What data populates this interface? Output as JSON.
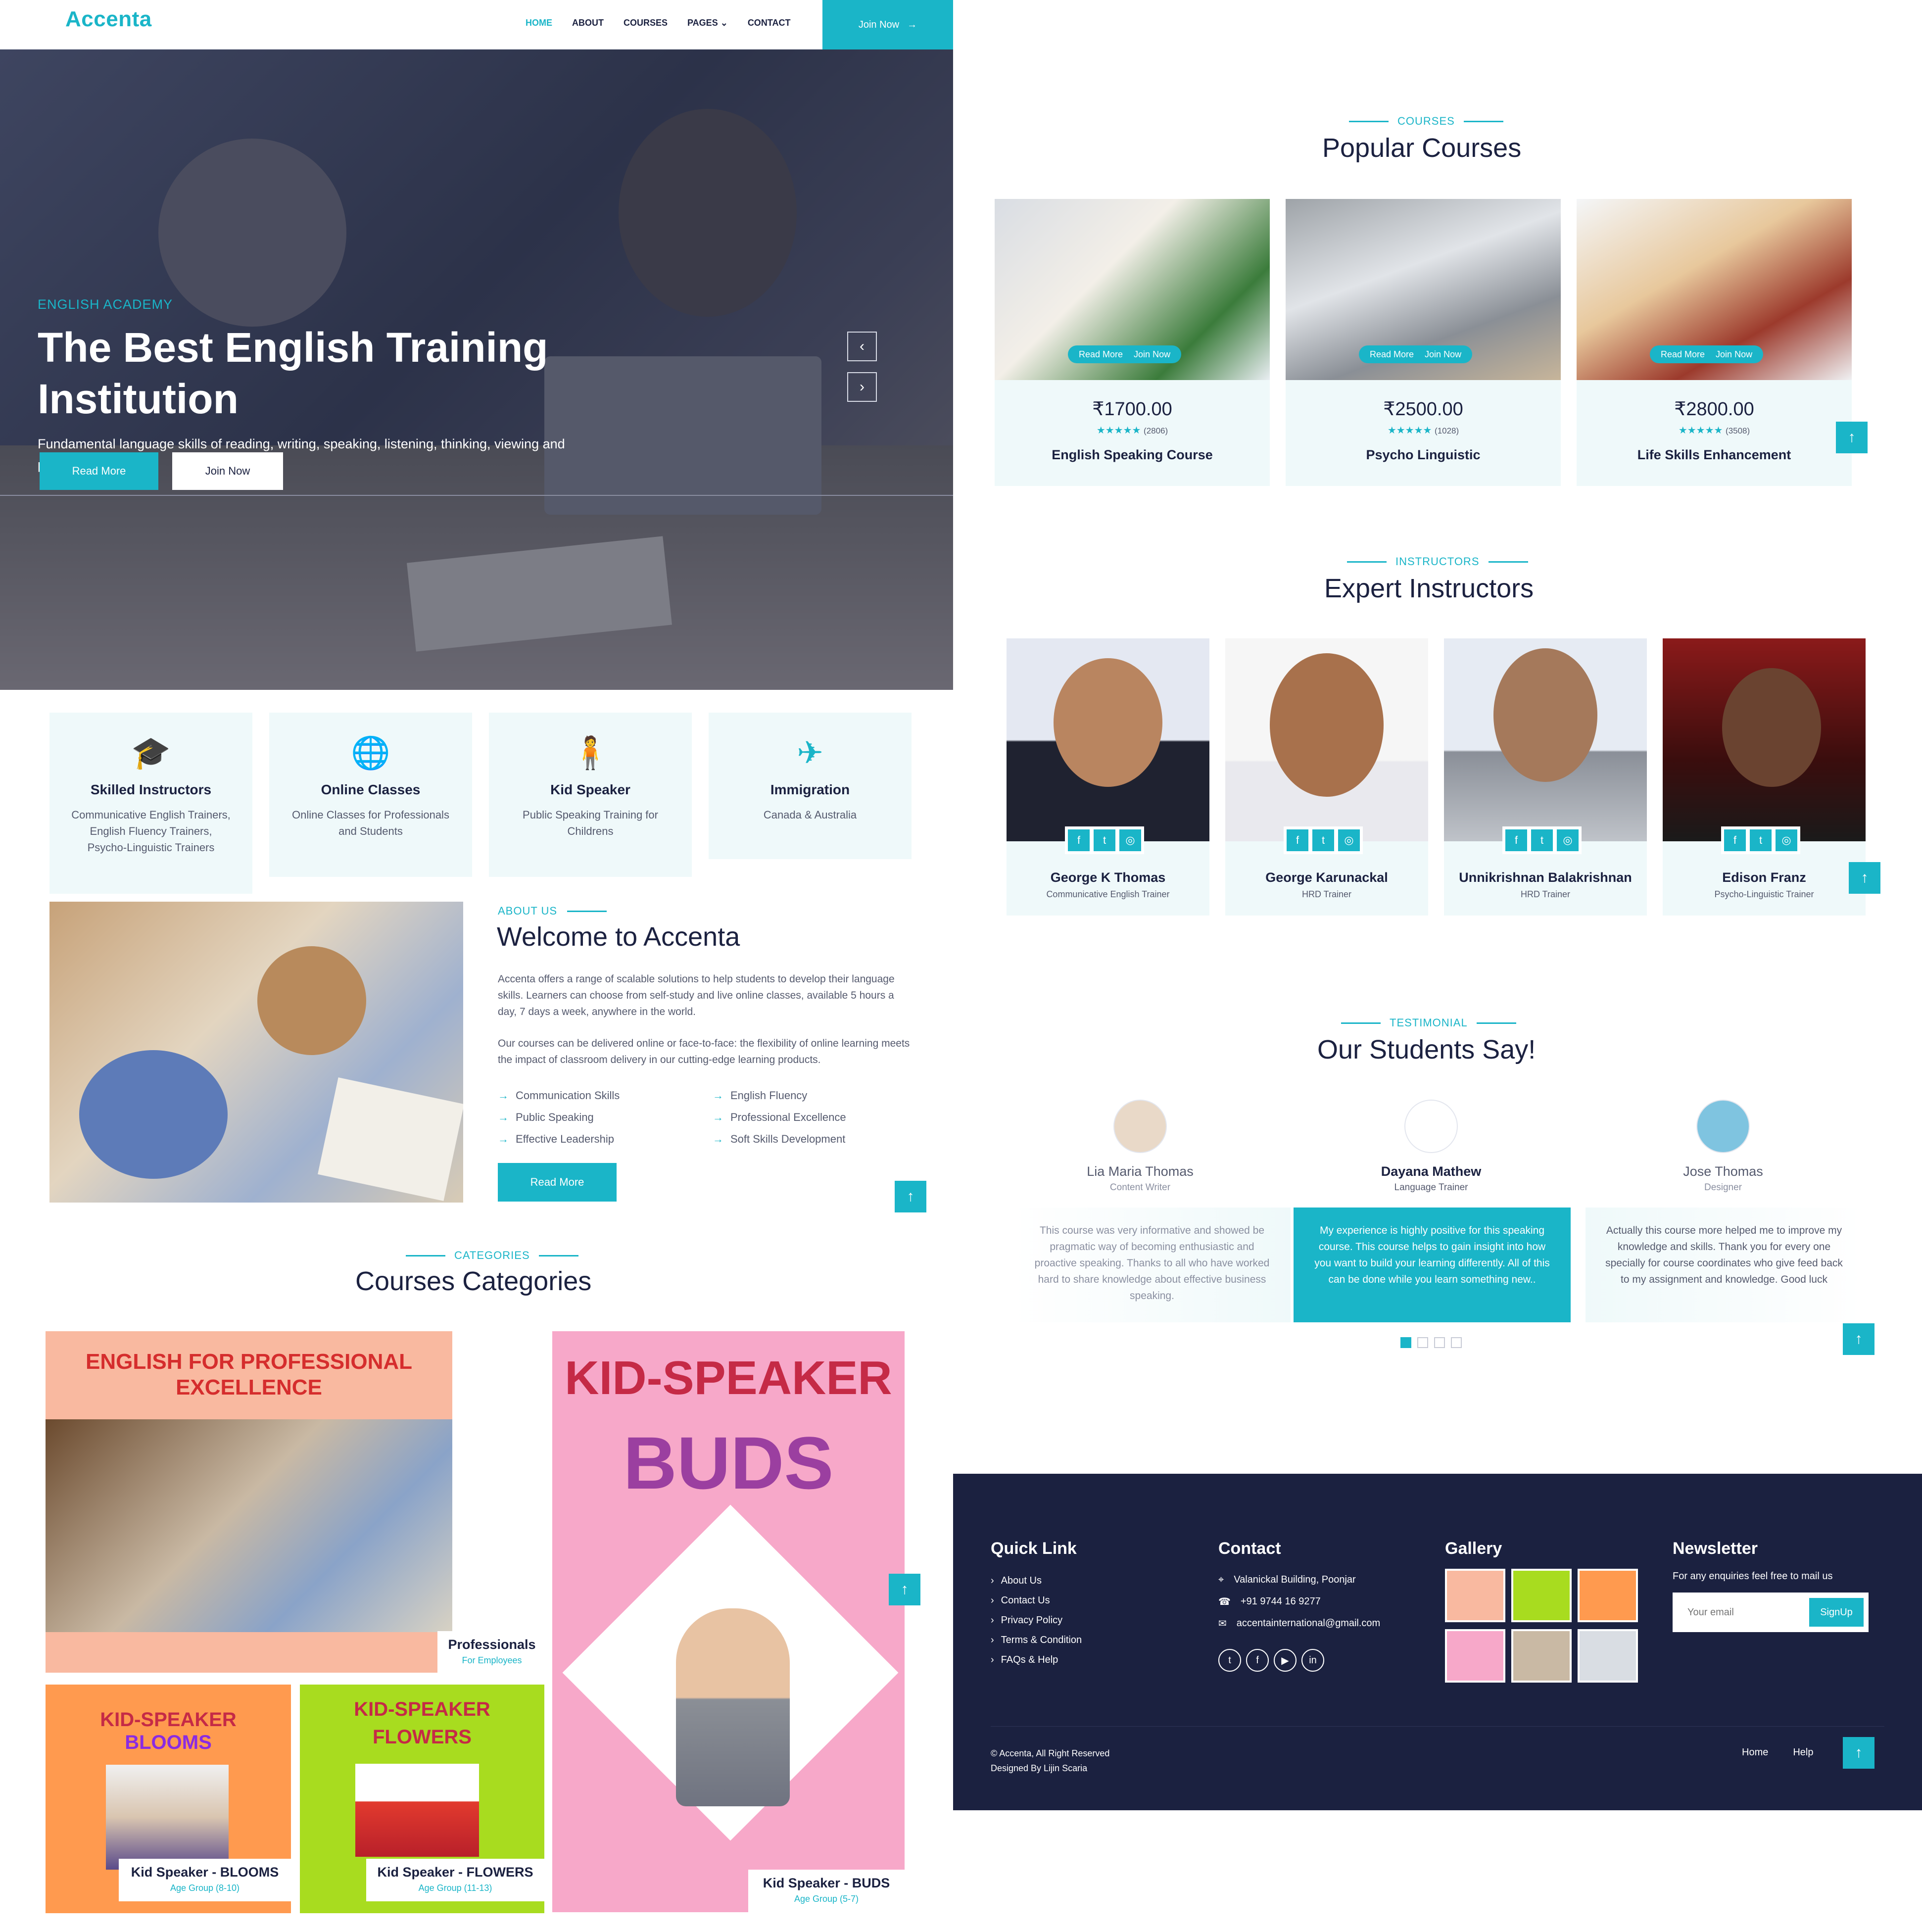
{
  "nav": {
    "logo": "Accenta",
    "items": [
      "HOME",
      "ABOUT",
      "COURSES",
      "PAGES",
      "CONTACT"
    ],
    "join_label": "Join Now"
  },
  "hero": {
    "subtitle": "ENGLISH ACADEMY",
    "title": "The Best English Training Institution",
    "description": "Fundamental language skills of reading, writing, speaking, listening, thinking, viewing and presenting.",
    "read_more": "Read More",
    "join_now": "Join Now"
  },
  "features": [
    {
      "icon": "graduation-cap-icon",
      "title": "Skilled Instructors",
      "desc": "Communicative English Trainers, English Fluency Trainers, Psycho-Linguistic Trainers"
    },
    {
      "icon": "globe-icon",
      "title": "Online Classes",
      "desc": "Online Classes for Professionals and Students"
    },
    {
      "icon": "child-icon",
      "title": "Kid Speaker",
      "desc": "Public Speaking Training for Childrens"
    },
    {
      "icon": "plane-icon",
      "title": "Immigration",
      "desc": "Canada & Australia"
    }
  ],
  "about": {
    "label": "ABOUT US",
    "title": "Welcome to Accenta",
    "p1": "Accenta offers a range of scalable solutions to help students to develop their language skills. Learners can choose from self-study and live online classes, available 5 hours a day, 7 days a week, anywhere in the world.",
    "p2": "Our courses can be delivered online or face-to-face: the flexibility of online learning meets the impact of classroom delivery in our cutting-edge learning products.",
    "list_left": [
      "Communication Skills",
      "Public Speaking",
      "Effective Leadership"
    ],
    "list_right": [
      "English Fluency",
      "Professional Excellence",
      "Soft Skills Development"
    ],
    "button": "Read More"
  },
  "categories": {
    "label": "CATEGORIES",
    "title": "Courses Categories",
    "items": [
      {
        "banner_line1": "ENGLISH FOR PROFESSIONAL",
        "banner_line2": "EXCELLENCE",
        "name": "Professionals",
        "sub": "For Employees"
      },
      {
        "banner_line1": "KID-SPEAKER",
        "banner_line2": "BUDS",
        "name": "Kid Speaker - BUDS",
        "sub": "Age Group (5-7)"
      },
      {
        "banner_line1": "KID-SPEAKER",
        "banner_line2": "BLOOMS",
        "name": "Kid Speaker - BLOOMS",
        "sub": "Age Group (8-10)"
      },
      {
        "banner_line1": "KID-SPEAKER",
        "banner_line2": "FLOWERS",
        "name": "Kid Speaker - FLOWERS",
        "sub": "Age Group (11-13)"
      }
    ]
  },
  "courses": {
    "label": "COURSES",
    "title": "Popular Courses",
    "read_more": "Read More",
    "join_now": "Join Now",
    "items": [
      {
        "price": "₹1700.00",
        "rating": 5,
        "count": "(2806)",
        "name": "English Speaking Course"
      },
      {
        "price": "₹2500.00",
        "rating": 5,
        "count": "(1028)",
        "name": "Psycho Linguistic"
      },
      {
        "price": "₹2800.00",
        "rating": 5,
        "count": "(3508)",
        "name": "Life Skills Enhancement"
      }
    ]
  },
  "instructors": {
    "label": "INSTRUCTORS",
    "title": "Expert Instructors",
    "items": [
      {
        "name": "George K Thomas",
        "role": "Communicative English Trainer"
      },
      {
        "name": "George Karunackal",
        "role": "HRD Trainer"
      },
      {
        "name": "Unnikrishnan Balakrishnan",
        "role": "HRD Trainer"
      },
      {
        "name": "Edison Franz",
        "role": "Psycho-Linguistic Trainer"
      }
    ]
  },
  "testimonials": {
    "label": "TESTIMONIAL",
    "title": "Our Students Say!",
    "items": [
      {
        "name": "Lia Maria Thomas",
        "role": "Content Writer",
        "text": "This course was very informative and showed be pragmatic way of becoming enthusiastic and proactive speaking. Thanks to all who have worked hard to share knowledge about effective business speaking."
      },
      {
        "name": "Dayana Mathew",
        "role": "Language Trainer",
        "text": "My experience is highly positive for this speaking course. This course helps to gain insight into how you want to build your learning differently. All of this can be done while you learn something new.."
      },
      {
        "name": "Jose Thomas",
        "role": "Designer",
        "text": "Actually this course more helped me to improve my knowledge and skills. Thank you for every one specially for course coordinates who give feed back to my assignment and knowledge. Good luck"
      }
    ]
  },
  "footer": {
    "quick_title": "Quick Link",
    "quick_links": [
      "About Us",
      "Contact Us",
      "Privacy Policy",
      "Terms & Condition",
      "FAQs & Help"
    ],
    "contact_title": "Contact",
    "address": "Valanickal Building, Poonjar",
    "phone": "+91 9744 16 9277",
    "email": "accentainternational@gmail.com",
    "gallery_title": "Gallery",
    "newsletter_title": "Newsletter",
    "newsletter_text": "For any enquiries feel free to mail us",
    "email_placeholder": "Your email",
    "signup": "SignUp",
    "copyright": "© Accenta, All Right Reserved",
    "designed": "Designed By Lijin Scaria",
    "bottom_links": [
      "Home",
      "Help"
    ]
  },
  "colors": {
    "accent": "#1ab5c8",
    "navy": "#1b2140",
    "light": "#eff9fa"
  }
}
